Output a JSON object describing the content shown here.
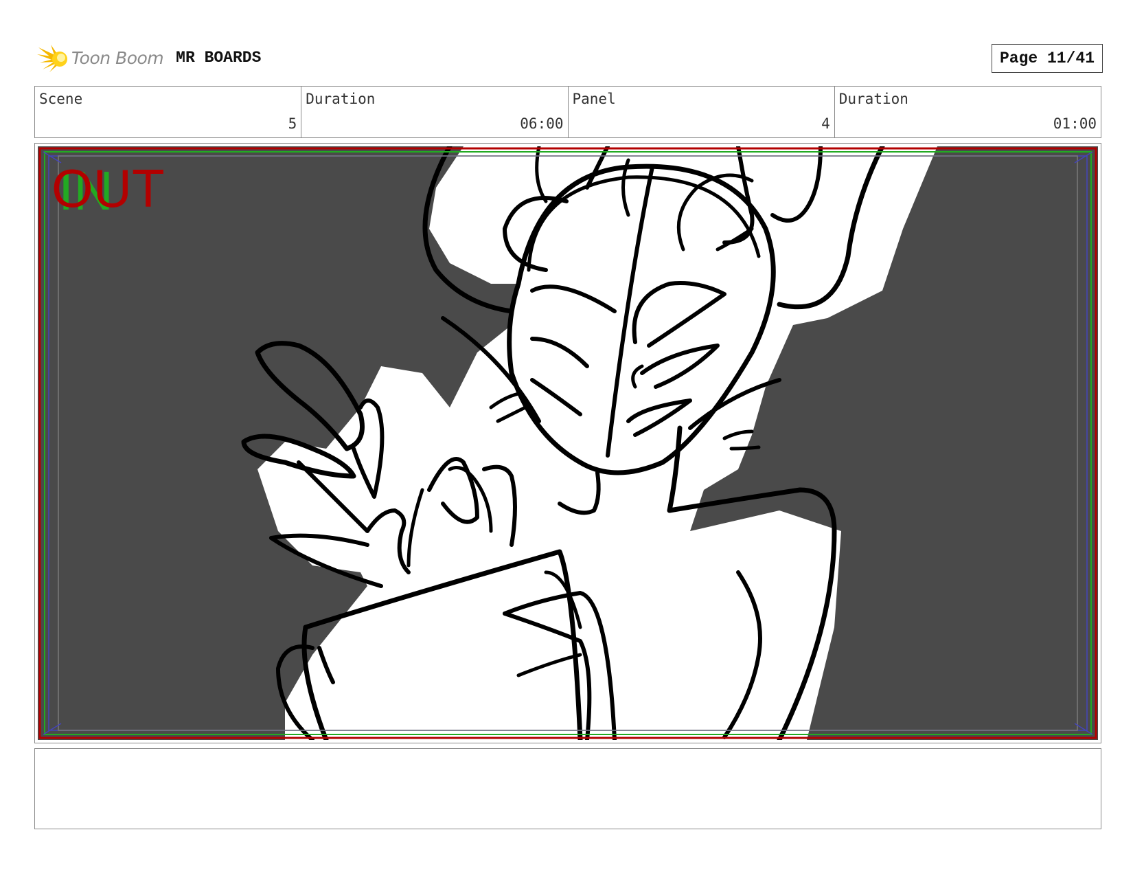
{
  "header": {
    "brand": "Toon Boom",
    "project_title": "MR BOARDS",
    "page_label": "Page 11/41"
  },
  "info": [
    {
      "label": "Scene",
      "value": "5"
    },
    {
      "label": "Duration",
      "value": "06:00"
    },
    {
      "label": "Panel",
      "value": "4"
    },
    {
      "label": "Duration",
      "value": "01:00"
    }
  ],
  "panel": {
    "overlay_out": "OUT",
    "overlay_in": "IN",
    "background_color": "#4a4a4a",
    "out_color": "#b30000",
    "in_color": "#22aa22"
  },
  "notes": ""
}
